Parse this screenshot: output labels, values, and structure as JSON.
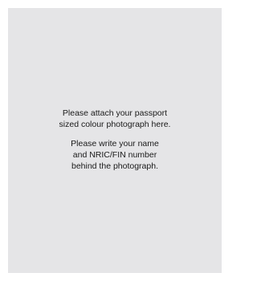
{
  "photo_box": {
    "colors": {
      "box_background": "#e5e5e7",
      "text": "#1a1a1a"
    },
    "attach_instruction": [
      "Please attach your passport",
      "sized colour photograph here."
    ],
    "write_instruction": [
      "Please write your name",
      "and NRIC/FIN number",
      "behind the photograph."
    ]
  }
}
